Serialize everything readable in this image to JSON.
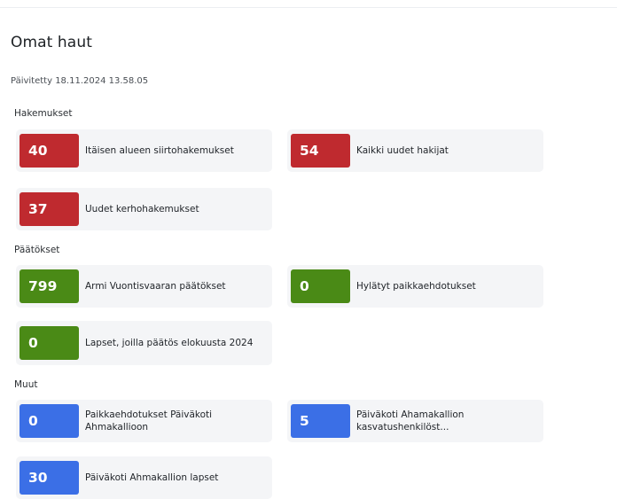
{
  "page": {
    "title": "Omat haut",
    "updated": "Päivitetty 18.11.2024 13.58.05"
  },
  "sections": [
    {
      "title": "Hakemukset",
      "cards": [
        {
          "count": "40",
          "label": "Itäisen alueen siirtohakemukset",
          "color": "#bf2a2f"
        },
        {
          "count": "54",
          "label": "Kaikki uudet hakijat",
          "color": "#bf2a2f"
        },
        {
          "count": "37",
          "label": "Uudet kerhohakemukset",
          "color": "#bf2a2f"
        }
      ]
    },
    {
      "title": "Päätökset",
      "cards": [
        {
          "count": "799",
          "label": "Armi Vuontisvaaran päätökset",
          "color": "#4a8a16"
        },
        {
          "count": "0",
          "label": "Hylätyt paikkaehdotukset",
          "color": "#4a8a16"
        },
        {
          "count": "0",
          "label": "Lapset, joilla päätös elokuusta 2024",
          "color": "#4a8a16"
        }
      ]
    },
    {
      "title": "Muut",
      "cards": [
        {
          "count": "0",
          "label": "Paikkaehdotukset Päiväkoti Ahmakallioon",
          "color": "#3b6fe6"
        },
        {
          "count": "5",
          "label": "Päiväkoti Ahamakallion kasvatushenkilöst...",
          "color": "#3b6fe6"
        },
        {
          "count": "30",
          "label": "Päiväkoti Ahmakallion lapset",
          "color": "#3b6fe6"
        }
      ]
    }
  ]
}
